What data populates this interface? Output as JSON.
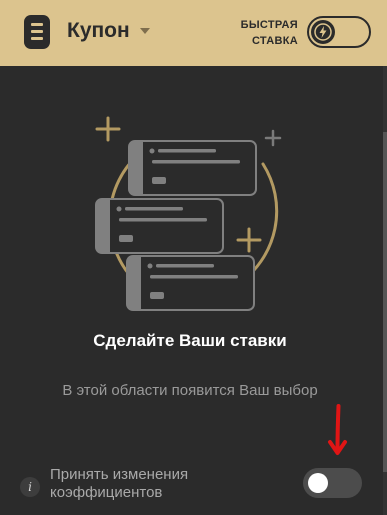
{
  "header": {
    "title": "Купон",
    "quick_bet_label": "БЫСТРАЯ СТАВКА",
    "quick_bet_enabled": false
  },
  "empty_state": {
    "title": "Сделайте Ваши ставки",
    "subtitle": "В этой области появится Ваш выбор"
  },
  "footer": {
    "odds_change_label": "Принять изменения коэффициентов",
    "odds_change_enabled": false
  },
  "colors": {
    "accent": "#dcc48e",
    "background": "#2b2b2b",
    "annotation_arrow": "#e01515"
  },
  "icons": [
    "menu-icon",
    "chevron-down-icon",
    "lightning-icon",
    "info-icon",
    "arrow-down-icon"
  ]
}
